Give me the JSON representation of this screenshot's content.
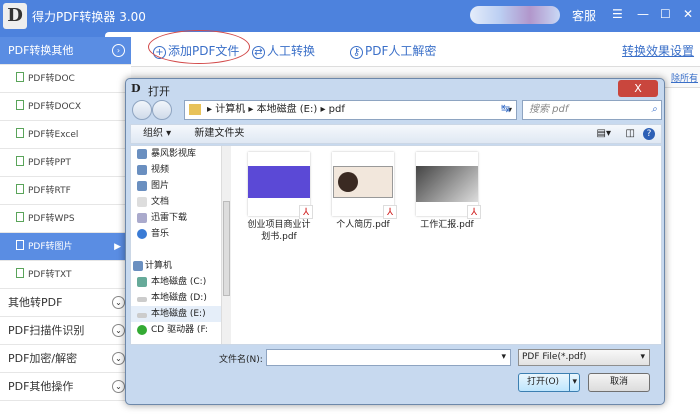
{
  "app": {
    "logo": "D",
    "title": "得力PDF转换器 3.00",
    "service": "客服",
    "menu_icon": "☰",
    "min_icon": "—",
    "max_icon": "☐",
    "close_icon": "✕"
  },
  "sidebar": {
    "items": [
      {
        "label": "PDF转换其他",
        "type": "group",
        "expanded": true
      },
      {
        "label": "PDF转DOC",
        "type": "sub"
      },
      {
        "label": "PDF转DOCX",
        "type": "sub"
      },
      {
        "label": "PDF转Excel",
        "type": "sub"
      },
      {
        "label": "PDF转PPT",
        "type": "sub"
      },
      {
        "label": "PDF转RTF",
        "type": "sub"
      },
      {
        "label": "PDF转WPS",
        "type": "sub"
      },
      {
        "label": "PDF转图片",
        "type": "sub",
        "selected": true
      },
      {
        "label": "PDF转TXT",
        "type": "sub"
      },
      {
        "label": "其他转PDF",
        "type": "group"
      },
      {
        "label": "PDF扫描件识别",
        "type": "group"
      },
      {
        "label": "PDF加密/解密",
        "type": "group"
      },
      {
        "label": "PDF其他操作",
        "type": "group"
      }
    ]
  },
  "toolbar": {
    "add": "添加PDF文件",
    "manual": "人工转换",
    "decrypt": "PDF人工解密",
    "settings": "转换效果设置",
    "clear_all": "除所有"
  },
  "dialog": {
    "title": "打开",
    "close": "X",
    "path": [
      "计算机",
      "本地磁盘 (E:)",
      "pdf"
    ],
    "search_placeholder": "搜索 pdf",
    "organize": "组织 ▾",
    "new_folder": "新建文件夹",
    "tree": [
      "暴风影视库",
      "视频",
      "图片",
      "文档",
      "迅雷下载",
      "音乐",
      "",
      "计算机",
      "本地磁盘 (C:)",
      "本地磁盘 (D:)",
      "本地磁盘 (E:)",
      "CD 驱动器 (F:"
    ],
    "files": [
      {
        "name": "创业项目商业计划书.pdf",
        "color": "#5b49d6"
      },
      {
        "name": "个人简历.pdf",
        "color": "#f2e7dc"
      },
      {
        "name": "工作汇报.pdf",
        "color": "#8a8a8a"
      }
    ],
    "filename_label": "文件名(N):",
    "filename_value": "",
    "filetype": "PDF File(*.pdf)",
    "open": "打开(O)",
    "cancel": "取消"
  }
}
